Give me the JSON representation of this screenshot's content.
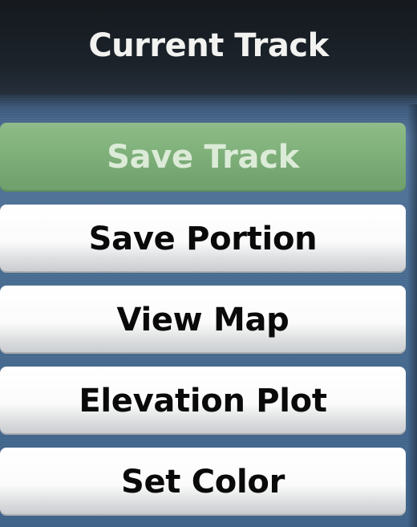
{
  "header": {
    "title": "Current Track"
  },
  "menu": {
    "items": [
      {
        "label": "Save Track",
        "selected": true
      },
      {
        "label": "Save Portion",
        "selected": false
      },
      {
        "label": "View Map",
        "selected": false
      },
      {
        "label": "Elevation Plot",
        "selected": false
      },
      {
        "label": "Set Color",
        "selected": false
      }
    ]
  },
  "colors": {
    "selected_button": "#7fb07a",
    "button": "#f8f8f8",
    "background": "#4a6d92",
    "title_bar": "#1a2028"
  }
}
